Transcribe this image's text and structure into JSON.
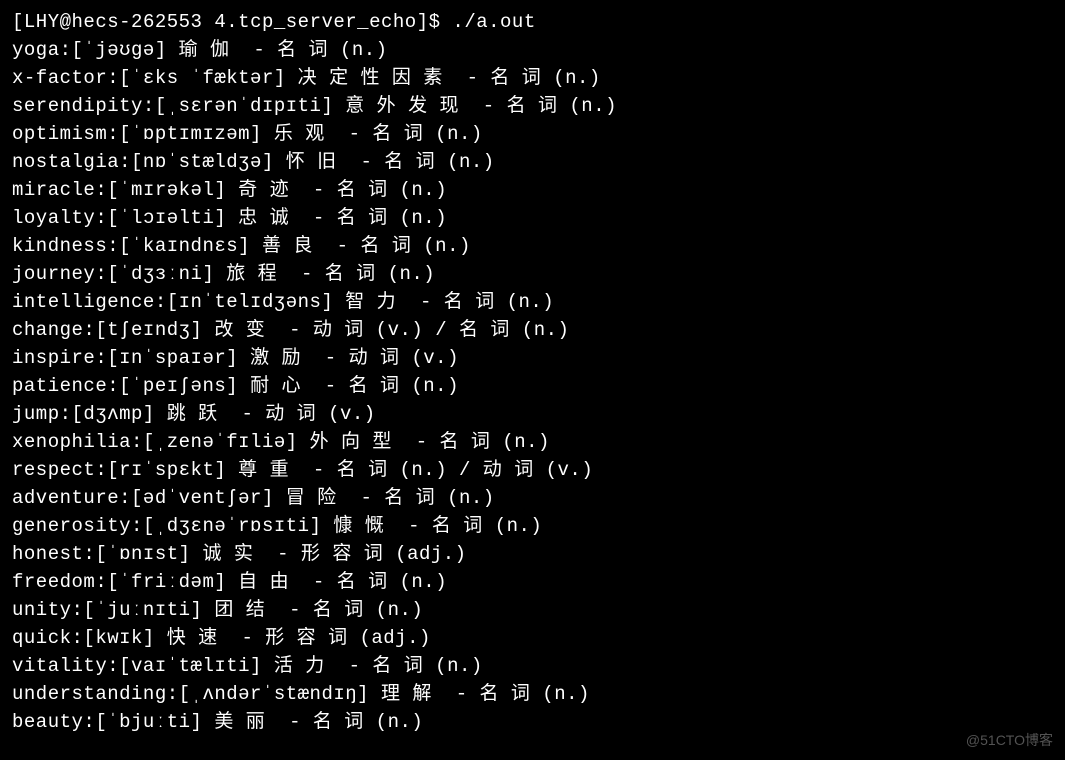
{
  "prompt": {
    "user": "LHY",
    "host": "hecs-262553",
    "cwd": "4.tcp_server_echo",
    "command": "./a.out"
  },
  "entries": [
    {
      "word": "yoga",
      "phonetic": "[ˈjəʊɡə]",
      "translation": "瑜伽",
      "pos": "名词 (n.)"
    },
    {
      "word": "x-factor",
      "phonetic": "[ˈɛks ˈfæktər]",
      "translation": "决定性因素",
      "pos": "名词 (n.)"
    },
    {
      "word": "serendipity",
      "phonetic": "[ˌsɛrənˈdɪpɪti]",
      "translation": "意外发现",
      "pos": "名词 (n.)"
    },
    {
      "word": "optimism",
      "phonetic": "[ˈɒptɪmɪzəm]",
      "translation": "乐观",
      "pos": "名词 (n.)"
    },
    {
      "word": "nostalgia",
      "phonetic": "[nɒˈstældʒə]",
      "translation": "怀旧",
      "pos": "名词 (n.)"
    },
    {
      "word": "miracle",
      "phonetic": "[ˈmɪrəkəl]",
      "translation": "奇迹",
      "pos": "名词 (n.)"
    },
    {
      "word": "loyalty",
      "phonetic": "[ˈlɔɪəlti]",
      "translation": "忠诚",
      "pos": "名词 (n.)"
    },
    {
      "word": "kindness",
      "phonetic": "[ˈkaɪndnɛs]",
      "translation": "善良",
      "pos": "名词 (n.)"
    },
    {
      "word": "journey",
      "phonetic": "[ˈdʒɜːni]",
      "translation": "旅程",
      "pos": "名词 (n.)"
    },
    {
      "word": "intelligence",
      "phonetic": "[ɪnˈtelɪdʒəns]",
      "translation": "智力",
      "pos": "名词 (n.)"
    },
    {
      "word": "change",
      "phonetic": "[tʃeɪndʒ]",
      "translation": "改变",
      "pos": "动词 (v.) / 名词 (n.)"
    },
    {
      "word": "inspire",
      "phonetic": "[ɪnˈspaɪər]",
      "translation": "激励",
      "pos": "动词 (v.)"
    },
    {
      "word": "patience",
      "phonetic": "[ˈpeɪʃəns]",
      "translation": "耐心",
      "pos": "名词 (n.)"
    },
    {
      "word": "jump",
      "phonetic": "[dʒʌmp]",
      "translation": "跳跃",
      "pos": "动词 (v.)"
    },
    {
      "word": "xenophilia",
      "phonetic": "[ˌzenəˈfɪliə]",
      "translation": "外向型",
      "pos": "名词 (n.)"
    },
    {
      "word": "respect",
      "phonetic": "[rɪˈspɛkt]",
      "translation": "尊重",
      "pos": "名词 (n.) / 动词 (v.)"
    },
    {
      "word": "adventure",
      "phonetic": "[ədˈventʃər]",
      "translation": "冒险",
      "pos": "名词 (n.)"
    },
    {
      "word": "generosity",
      "phonetic": "[ˌdʒɛnəˈrɒsɪti]",
      "translation": "慷慨",
      "pos": "名词 (n.)"
    },
    {
      "word": "honest",
      "phonetic": "[ˈɒnɪst]",
      "translation": "诚实",
      "pos": "形容词 (adj.)"
    },
    {
      "word": "freedom",
      "phonetic": "[ˈfriːdəm]",
      "translation": "自由",
      "pos": "名词 (n.)"
    },
    {
      "word": "unity",
      "phonetic": "[ˈjuːnɪti]",
      "translation": "团结",
      "pos": "名词 (n.)"
    },
    {
      "word": "quick",
      "phonetic": "[kwɪk]",
      "translation": "快速",
      "pos": "形容词 (adj.)"
    },
    {
      "word": "vitality",
      "phonetic": "[vaɪˈtælɪti]",
      "translation": "活力",
      "pos": "名词 (n.)"
    },
    {
      "word": "understanding",
      "phonetic": "[ˌʌndərˈstændɪŋ]",
      "translation": "理解",
      "pos": "名词 (n.)"
    },
    {
      "word": "beauty",
      "phonetic": "[ˈbjuːti]",
      "translation": "美丽",
      "pos": "名词 (n.)"
    }
  ],
  "watermark": "@51CTO博客"
}
